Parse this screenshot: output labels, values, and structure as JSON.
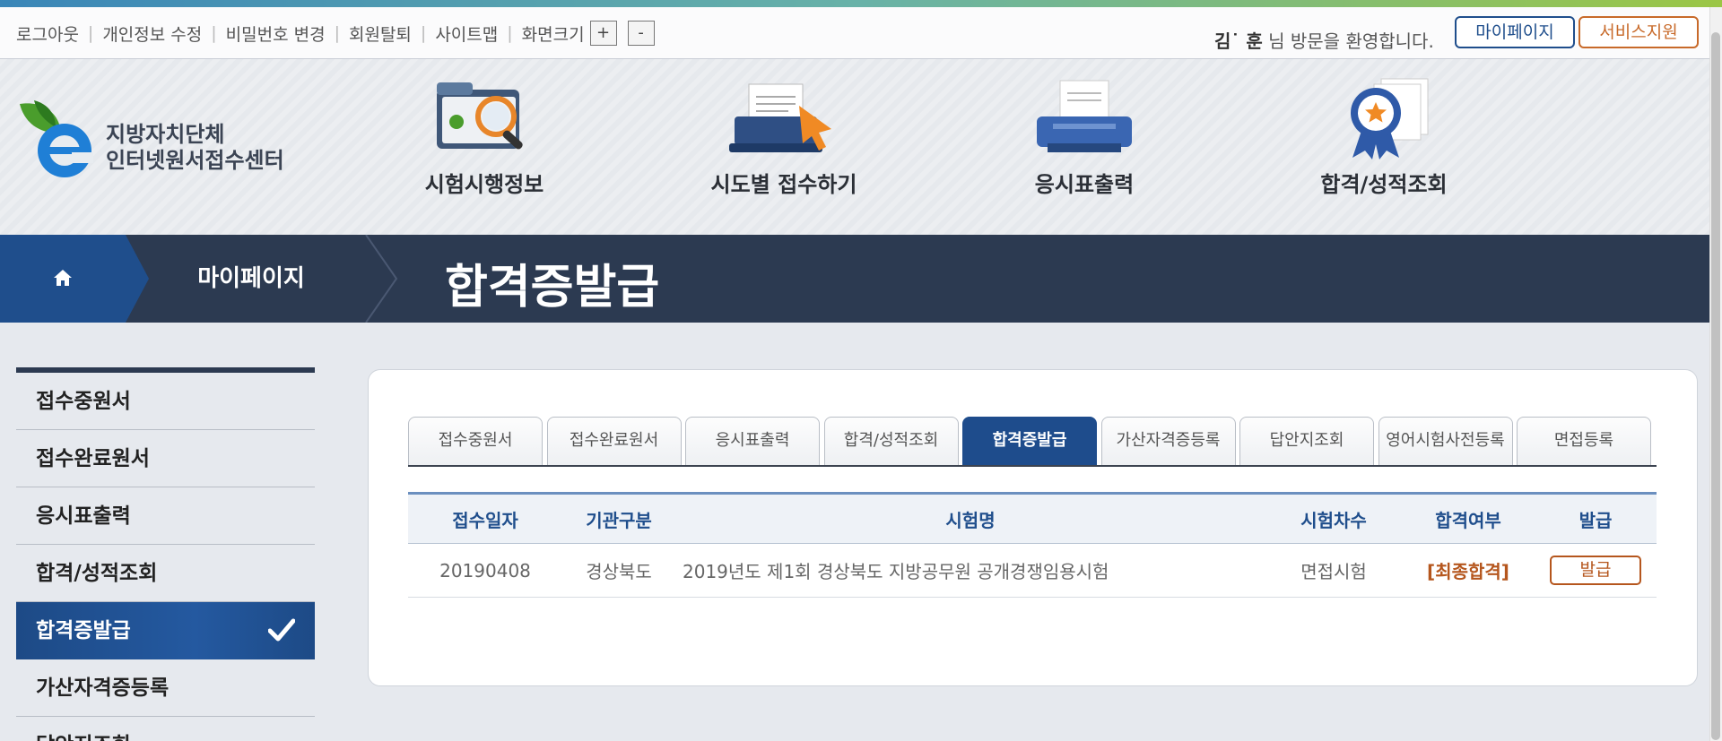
{
  "util": {
    "links": [
      "로그아웃",
      "개인정보 수정",
      "비밀번호 변경",
      "회원탈퇴",
      "사이트맵",
      "화면크기"
    ],
    "zoom_in": "+",
    "zoom_out": "-",
    "user_name": "김˙ 훈",
    "welcome_suffix": "님 방문을 환영합니다.",
    "mypage_button": "마이페이지",
    "support_button": "서비스지원"
  },
  "header": {
    "logo_line1": "지방자치단체",
    "logo_line2": "인터넷원서접수센터",
    "nav": [
      {
        "label": "시험시행정보",
        "icon": "folder-magnifier-icon"
      },
      {
        "label": "시도별 접수하기",
        "icon": "laptop-cursor-icon"
      },
      {
        "label": "응시표출력",
        "icon": "printer-icon"
      },
      {
        "label": "합격/성적조회",
        "icon": "award-ribbon-icon"
      }
    ]
  },
  "location": {
    "home_icon": "home-icon",
    "parent": "마이페이지",
    "title": "합격증발급"
  },
  "sidebar": {
    "items": [
      {
        "label": "접수중원서"
      },
      {
        "label": "접수완료원서"
      },
      {
        "label": "응시표출력"
      },
      {
        "label": "합격/성적조회"
      },
      {
        "label": "합격증발급",
        "active": true
      },
      {
        "label": "가산자격증등록"
      },
      {
        "label": "답안지조회"
      }
    ]
  },
  "tabs": [
    "접수중원서",
    "접수완료원서",
    "응시표출력",
    "합격/성적조회",
    "합격증발급",
    "가산자격증등록",
    "답안지조회",
    "영어시험사전등록",
    "면접등록"
  ],
  "active_tab": "합격증발급",
  "table": {
    "columns": [
      "접수일자",
      "기관구분",
      "시험명",
      "시험차수",
      "합격여부",
      "발급"
    ],
    "rows": [
      {
        "date": "20190408",
        "agency": "경상북도",
        "exam": "2019년도 제1회 경상북도 지방공무원 공개경쟁임용시험",
        "round": "면접시험",
        "result": "[최종합격]",
        "action": "발급"
      }
    ]
  },
  "colors": {
    "primary": "#1f4e8c",
    "dark": "#2c3a51",
    "accent": "#b5561d",
    "support": "#c86a2a"
  }
}
